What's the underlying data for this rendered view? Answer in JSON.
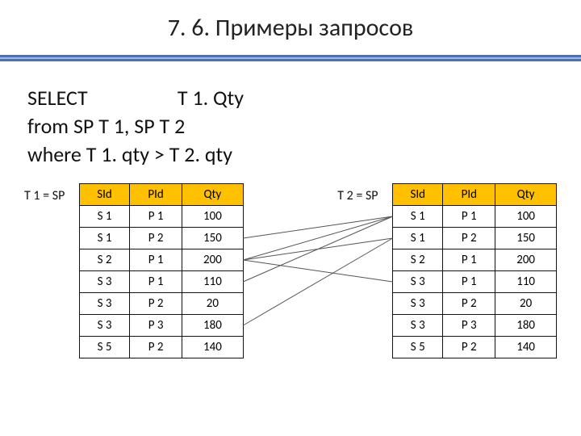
{
  "title": "7. 6. Примеры запросов",
  "sql": {
    "line1a": "SELECT",
    "line1b": "T 1. Qty",
    "line2": "from SP T 1, SP T 2",
    "line3": "where T 1. qty > T 2. qty"
  },
  "table1": {
    "label": "T 1 = SP",
    "headers": [
      "SId",
      "PId",
      "Qty"
    ],
    "rows": [
      [
        "S 1",
        "P 1",
        "100"
      ],
      [
        "S 1",
        "P 2",
        "150"
      ],
      [
        "S 2",
        "P 1",
        "200"
      ],
      [
        "S 3",
        "P 1",
        "110"
      ],
      [
        "S 3",
        "P 2",
        "20"
      ],
      [
        "S 3",
        "P 3",
        "180"
      ],
      [
        "S 5",
        "P 2",
        "140"
      ]
    ]
  },
  "table2": {
    "label": "T 2 = SP",
    "headers": [
      "SId",
      "PId",
      "Qty"
    ],
    "rows": [
      [
        "S 1",
        "P 1",
        "100"
      ],
      [
        "S 1",
        "P 2",
        "150"
      ],
      [
        "S 2",
        "P 1",
        "200"
      ],
      [
        "S 3",
        "P 1",
        "110"
      ],
      [
        "S 3",
        "P 2",
        "20"
      ],
      [
        "S 3",
        "P 3",
        "180"
      ],
      [
        "S 5",
        "P 2",
        "140"
      ]
    ]
  },
  "lines": [
    {
      "from": 1,
      "to": 0
    },
    {
      "from": 2,
      "to": 0
    },
    {
      "from": 2,
      "to": 1
    },
    {
      "from": 2,
      "to": 3
    },
    {
      "from": 3,
      "to": 0
    },
    {
      "from": 5,
      "to": 1
    }
  ]
}
